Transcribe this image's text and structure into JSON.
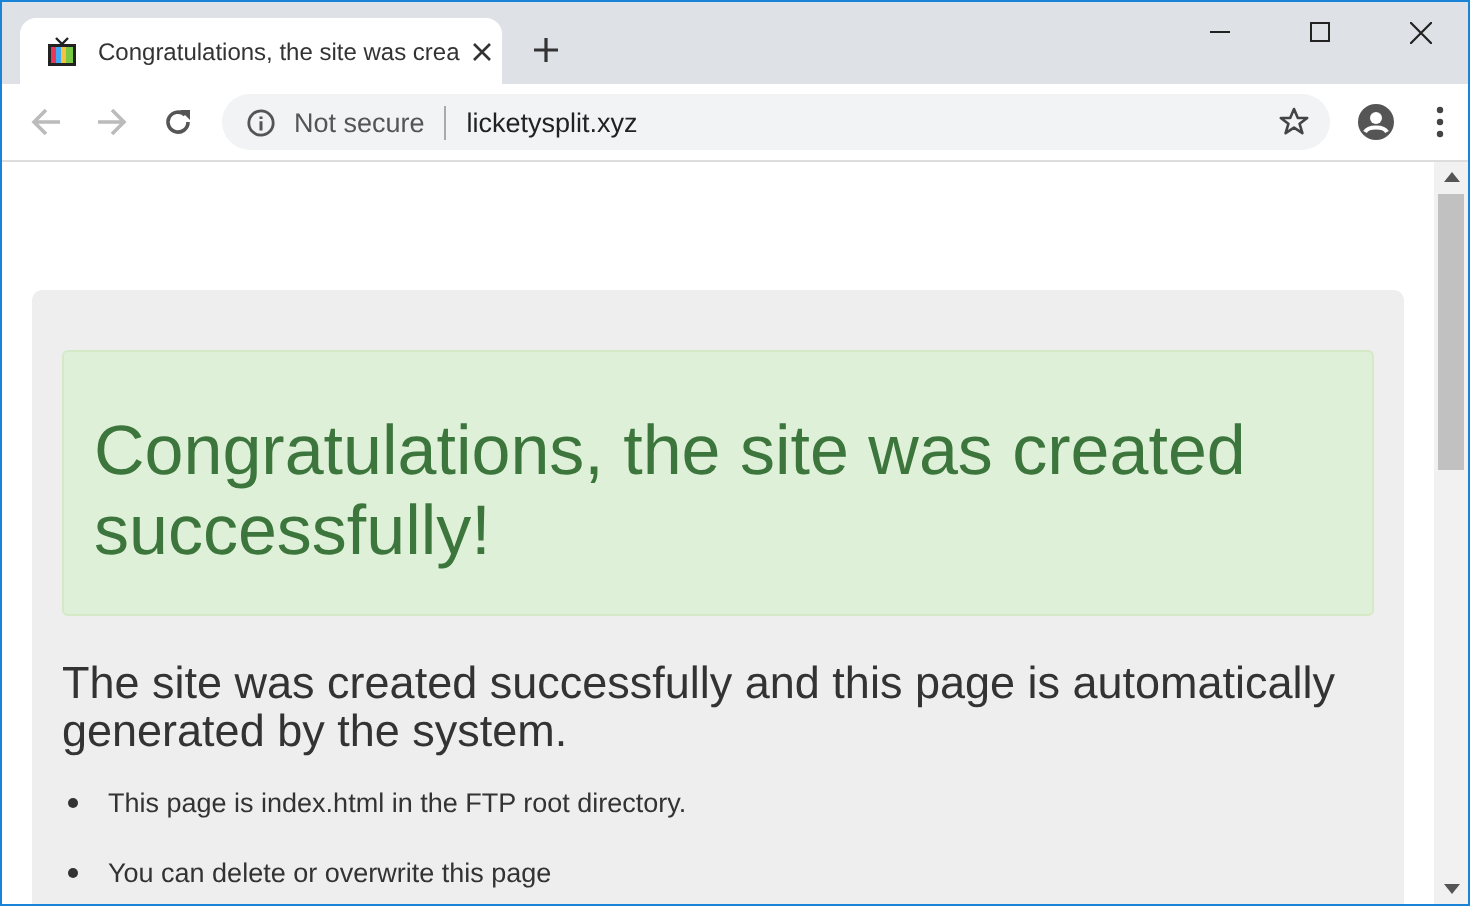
{
  "tab": {
    "title": "Congratulations, the site was crea",
    "selected": true
  },
  "address_bar": {
    "security": "Not secure",
    "url": "licketysplit.xyz"
  },
  "page": {
    "alert": "Congratulations, the site was created successfully!",
    "heading": "The site was created successfully and this page is automatically generated by the system.",
    "bullets": [
      "This page is index.html in the FTP root directory.",
      "You can delete or overwrite this page"
    ]
  }
}
